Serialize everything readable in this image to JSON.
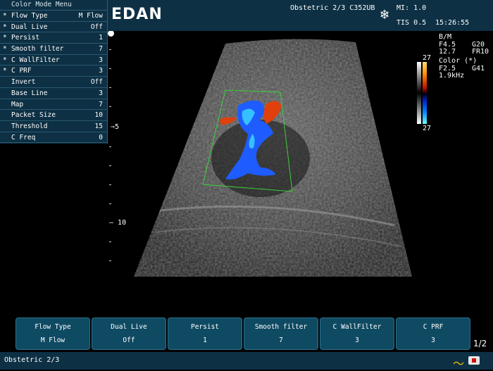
{
  "header": {
    "logo": "EDAN",
    "study": "Obstetric 2/3 C352UB",
    "mi": "MI: 1.0",
    "tis": "TIS 0.5",
    "time": "15:26:55",
    "freeze_icon": "snowflake-icon"
  },
  "menu": {
    "title": "Color Mode Menu",
    "items": [
      {
        "star": "*",
        "label": "Flow Type",
        "value": "M Flow"
      },
      {
        "star": "*",
        "label": "Dual Live",
        "value": "Off"
      },
      {
        "star": "*",
        "label": "Persist",
        "value": "1"
      },
      {
        "star": "*",
        "label": "Smooth filter",
        "value": "7"
      },
      {
        "star": "*",
        "label": "C WallFilter",
        "value": "3"
      },
      {
        "star": "*",
        "label": "C PRF",
        "value": "3"
      },
      {
        "star": "",
        "label": "Invert",
        "value": "Off"
      },
      {
        "star": "",
        "label": "Base Line",
        "value": "3"
      },
      {
        "star": "",
        "label": "Map",
        "value": "7"
      },
      {
        "star": "",
        "label": "Packet Size",
        "value": "10"
      },
      {
        "star": "",
        "label": "Threshold",
        "value": "15"
      },
      {
        "star": "",
        "label": "C Freq",
        "value": "0"
      }
    ]
  },
  "params": {
    "bm_label": "B/M",
    "b_freq": "F4.5",
    "b_gain": "G20",
    "b_depth": "12.7",
    "b_fr": "FR10",
    "color_label": "Color (*)",
    "c_freq": "F2.5",
    "c_gain": "G41",
    "c_prf": "1.9kHz"
  },
  "colorbar": {
    "top": "27",
    "bottom": "27"
  },
  "depth": {
    "five": "5",
    "ten": "10"
  },
  "softkeys": [
    {
      "label": "Flow Type",
      "value": "M Flow"
    },
    {
      "label": "Dual Live",
      "value": "Off"
    },
    {
      "label": "Persist",
      "value": "1"
    },
    {
      "label": "Smooth filter",
      "value": "7"
    },
    {
      "label": "C WallFilter",
      "value": "3"
    },
    {
      "label": "C PRF",
      "value": "3"
    }
  ],
  "page_indicator": "1/2",
  "footer": {
    "exam": "Obstetric 2/3"
  },
  "colors": {
    "panel": "#0d3044",
    "softkey": "#0f4a63",
    "roi": "#3ccf3c",
    "flow_red": "#e0400c",
    "flow_blue": "#1e5cff"
  }
}
